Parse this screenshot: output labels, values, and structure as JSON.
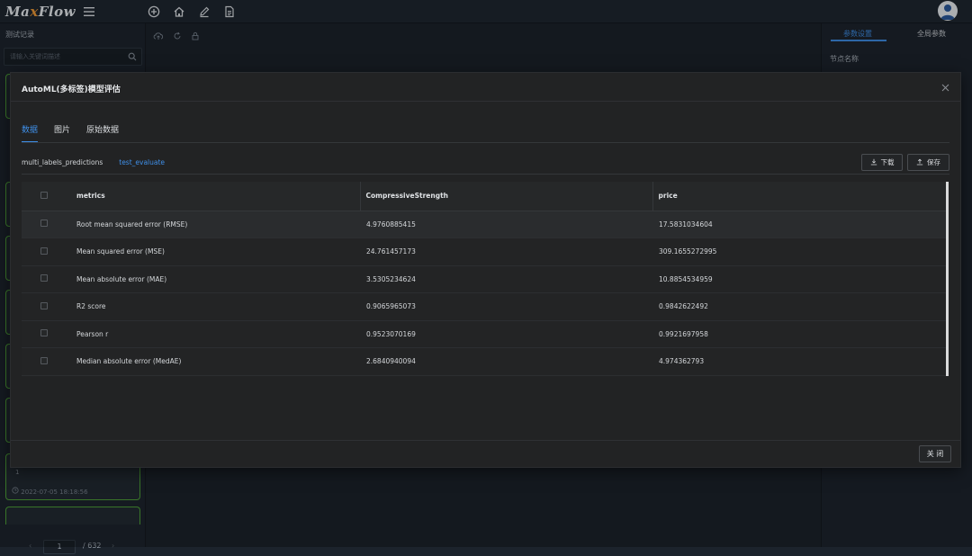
{
  "app": {
    "logo_prefix": "Ma",
    "logo_accent": "x",
    "logo_suffix": "Flow"
  },
  "sidebar": {
    "title": "测试记录",
    "search_placeholder": "请输入关键词描述",
    "record": {
      "index": "1",
      "timestamp": "2022-07-05 18:18:56"
    },
    "pager": {
      "current": "1",
      "total": "/ 632"
    }
  },
  "right_panel": {
    "tabs": [
      "参数设置",
      "全局参数"
    ],
    "node_name_label": "节点名称"
  },
  "modal": {
    "title": "AutoML(多标签)模型评估",
    "tabs": [
      {
        "label": "数据",
        "active": true
      },
      {
        "label": "图片",
        "active": false
      },
      {
        "label": "原始数据",
        "active": false
      }
    ],
    "subtabs": [
      {
        "label": "multi_labels_predictions",
        "active": false
      },
      {
        "label": "test_evaluate",
        "active": true
      }
    ],
    "download_label": "下载",
    "save_label": "保存",
    "table": {
      "columns": [
        "metrics",
        "CompressiveStrength",
        "price"
      ],
      "rows": [
        [
          "Root mean squared error (RMSE)",
          "4.9760885415",
          "17.5831034604"
        ],
        [
          "Mean squared error (MSE)",
          "24.761457173",
          "309.1655272995"
        ],
        [
          "Mean absolute error (MAE)",
          "3.5305234624",
          "10.8854534959"
        ],
        [
          "R2 score",
          "0.9065965073",
          "0.9842622492"
        ],
        [
          "Pearson r",
          "0.9523070169",
          "0.9921697958"
        ],
        [
          "Median absolute error (MedAE)",
          "2.6840940094",
          "4.974362793"
        ]
      ]
    },
    "close_label": "关 闭"
  },
  "colors": {
    "accent": "#3f8fe8",
    "card_border": "#4fa33a",
    "logo_accent": "#f29b38"
  }
}
